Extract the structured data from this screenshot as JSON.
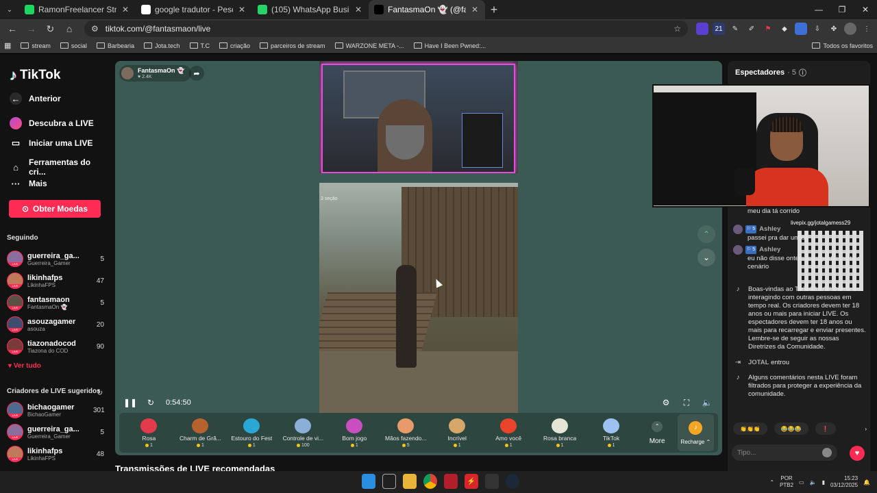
{
  "browser": {
    "tabs": [
      {
        "title": "RamonFreelancer Stream - Watc",
        "color": "#1ed760",
        "active": false
      },
      {
        "title": "google tradutor - Pesquisa Goo",
        "color": "#ffffff",
        "active": false
      },
      {
        "title": "(105) WhatsApp Business",
        "color": "#25d366",
        "active": false
      },
      {
        "title": "FantasmaOn 👻 (@fantasm",
        "color": "#000000",
        "active": true
      }
    ],
    "new_tab": "+",
    "url": "tiktok.com/@fantasmaon/live",
    "ext_badge": "21",
    "bookmarks": [
      "stream",
      "social",
      "Barbearia",
      "Jota.tech",
      "T.C",
      "criação",
      "parceiros de stream",
      "WARZONE META -...",
      "Have I Been Pwned:..."
    ],
    "bookmarks_all": "Todos os favoritos"
  },
  "tiktok": {
    "logo": "TikTok",
    "nav": {
      "back": "Anterior",
      "discover": "Descubra a LIVE",
      "go_live": "Iniciar uma LIVE",
      "creator_tools": "Ferramentas do cri...",
      "more": "Mais"
    },
    "coins_button": "Obter Moedas",
    "following_title": "Seguindo",
    "following": [
      {
        "name": "guerreira_ga...",
        "sub": "Guerreira_Gamer",
        "count": "5",
        "color": "#8a6f9e"
      },
      {
        "name": "likinhafps",
        "sub": "LikinhaFPS",
        "count": "47",
        "color": "#c07a5a"
      },
      {
        "name": "fantasmaon",
        "sub": "FantasmaOn 👻",
        "count": "5",
        "color": "#5c5045"
      },
      {
        "name": "asouzagamer",
        "sub": "asouza",
        "count": "20",
        "color": "#3e4c6e"
      },
      {
        "name": "tiazonadocod",
        "sub": "Tiazona do COD",
        "count": "90",
        "color": "#7a3a3a"
      }
    ],
    "see_all": "Ver tudo",
    "suggested_title": "Criadores de LIVE sugeridos",
    "suggested": [
      {
        "name": "bichaogamer",
        "sub": "BichaoGamer",
        "count": "301",
        "color": "#4e6a8e"
      },
      {
        "name": "guerreira_ga...",
        "sub": "Guerreira_Gamer",
        "count": "5",
        "color": "#8a6f9e"
      },
      {
        "name": "likinhafps",
        "sub": "LikinhaFPS",
        "count": "48",
        "color": "#c07a5a"
      }
    ]
  },
  "player": {
    "host_name": "FantasmaOn 👻",
    "host_likes": "2.4K",
    "game_tag": "3 seção",
    "elapsed": "0:54:50",
    "gifts": [
      {
        "name": "Rosa",
        "price": "1",
        "color": "#e23b4b"
      },
      {
        "name": "Charm de Grã...",
        "price": "1",
        "color": "#b5622d"
      },
      {
        "name": "Estouro do Fest",
        "price": "1",
        "color": "#2ba7d6"
      },
      {
        "name": "Controle de vi...",
        "price": "100",
        "color": "#8ab0d8"
      },
      {
        "name": "Bom jogo",
        "price": "1",
        "color": "#c94fc1"
      },
      {
        "name": "Mãos fazendo...",
        "price": "5",
        "color": "#e89a6a"
      },
      {
        "name": "Incrível",
        "price": "1",
        "color": "#d7a76a"
      },
      {
        "name": "Amo você",
        "price": "1",
        "color": "#e8442c"
      },
      {
        "name": "Rosa branca",
        "price": "1",
        "color": "#e5e5d5"
      },
      {
        "name": "TikTok",
        "price": "1",
        "color": "#9bc2f0"
      }
    ],
    "more": "More",
    "recharge": "Recharge"
  },
  "recommended_title": "Transmissões de LIVE recomendadas",
  "chat": {
    "viewers_label": "Espectadores",
    "viewers_count": "· 5",
    "partial_msg": "meu dia tá corrido",
    "qr_label": "livepix.gg/jotalgamess29",
    "messages": [
      {
        "badge": "5",
        "user": "Ashley",
        "text": "passei pra dar um ol"
      },
      {
        "badge": "5",
        "user": "Ashley",
        "text": "eu não disse ontem mas gostei muito o cenário"
      }
    ],
    "welcome": "Boas-vindas ao TikTok LIVE! Divirta-se interagindo com outras pessoas em tempo real. Os criadores devem ter 18 anos ou mais para iniciar LIVE. Os espectadores devem ter 18 anos ou mais para recarregar e enviar presentes. Lembre-se de seguir as nossas Diretrizes da Comunidade.",
    "joined_user": "JOTAL",
    "joined_text": "entrou",
    "filtered": "Alguns comentários nesta LIVE foram filtrados para proteger a experiência da comunidade.",
    "reactions": [
      "👏👏👏",
      "😂😂😂",
      "❗"
    ],
    "input_placeholder": "Tipo..."
  },
  "taskbar": {
    "lang": "POR",
    "lang_sub": "PTB2",
    "time": "15:23",
    "date": "03/12/2025"
  }
}
